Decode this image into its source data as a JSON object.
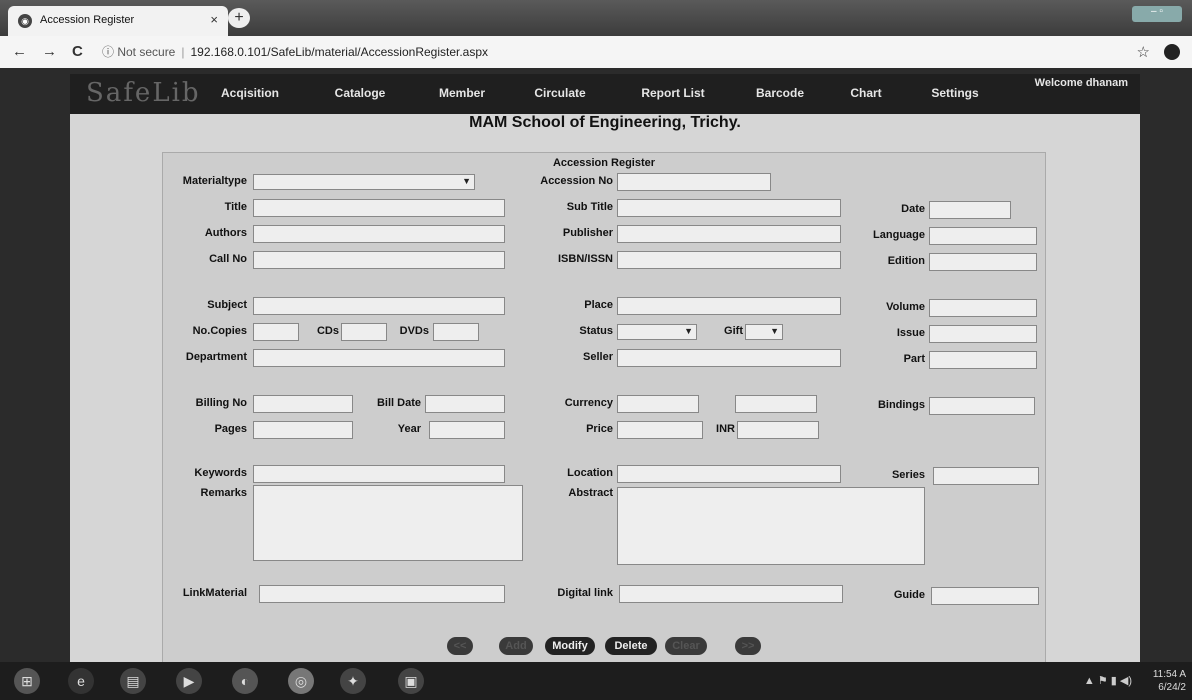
{
  "browser": {
    "tab_title": "Accession Register",
    "tab_close": "×",
    "new_tab": "+",
    "back": "←",
    "forward": "→",
    "reload": "C",
    "security": "ⓘ Not secure",
    "url": "192.168.0.101/SafeLib/material/AccessionRegister.aspx",
    "star": "☆"
  },
  "app": {
    "logo": "SafeLib",
    "menu": [
      "Acqisition",
      "Cataloge",
      "Member",
      "Circulate",
      "Report List",
      "Barcode",
      "Chart",
      "Settings"
    ],
    "welcome": "Welcome dhanam",
    "school": "MAM School of Engineering, Trichy."
  },
  "form": {
    "title": "Accession Register",
    "labels": {
      "materialtype": "Materialtype",
      "accession_no": "Accession No",
      "title": "Title",
      "sub_title": "Sub Title",
      "date": "Date",
      "authors": "Authors",
      "publisher": "Publisher",
      "language": "Language",
      "call_no": "Call No",
      "isbn": "ISBN/ISSN",
      "edition": "Edition",
      "subject": "Subject",
      "place": "Place",
      "volume": "Volume",
      "no_copies": "No.Copies",
      "cds": "CDs",
      "dvds": "DVDs",
      "status": "Status",
      "gift": "Gift",
      "issue": "Issue",
      "department": "Department",
      "seller": "Seller",
      "part": "Part",
      "billing_no": "Billing No",
      "bill_date": "Bill Date",
      "currency": "Currency",
      "bindings": "Bindings",
      "pages": "Pages",
      "year": "Year",
      "price": "Price",
      "inr": "INR",
      "keywords": "Keywords",
      "location": "Location",
      "series": "Series",
      "remarks": "Remarks",
      "abstract": "Abstract",
      "link_material": "LinkMaterial",
      "digital_link": "Digital link",
      "guide": "Guide"
    },
    "buttons": {
      "first": "<<",
      "add": "Add",
      "modify": "Modify",
      "delete": "Delete",
      "clear": "Clear",
      "last": ">>"
    }
  },
  "taskbar": {
    "time": "11:54 A",
    "date": "6/24/2"
  }
}
